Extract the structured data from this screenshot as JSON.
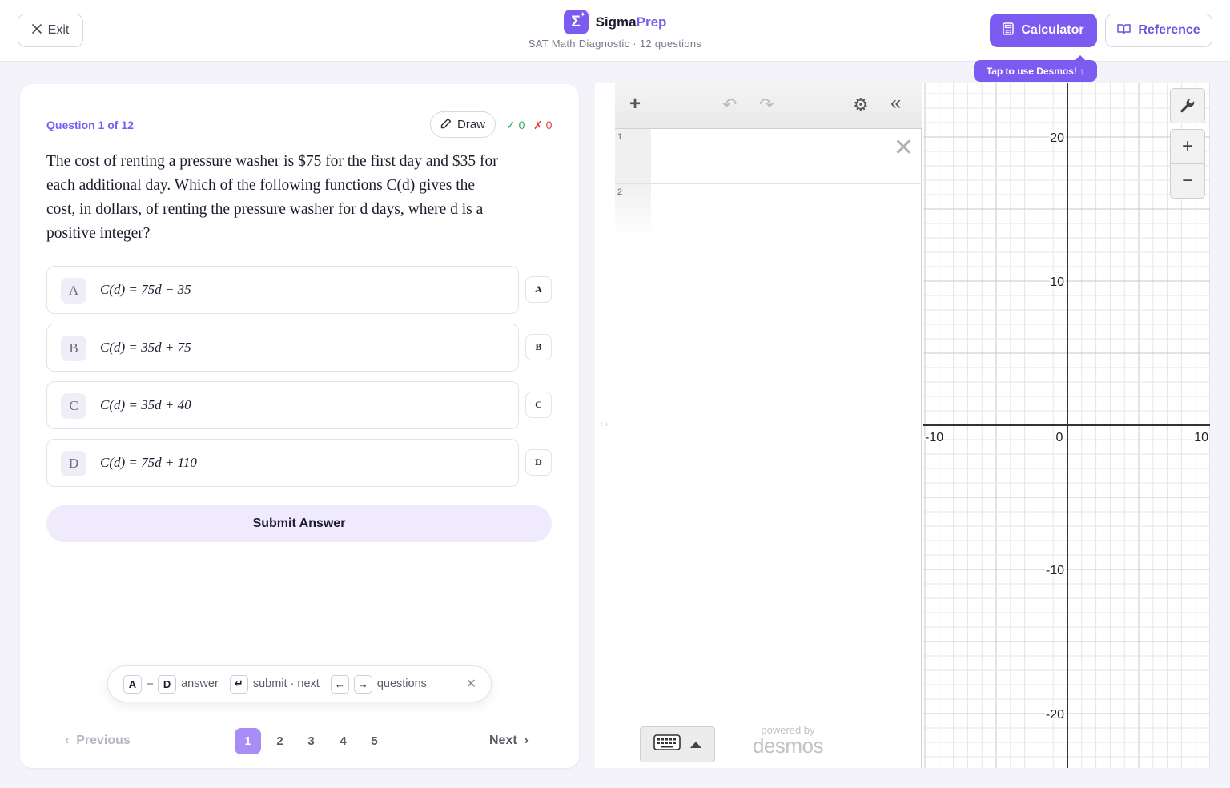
{
  "header": {
    "exit_label": "Exit",
    "brand_name": "Sigma",
    "brand_name_accent": "Prep",
    "brand_logo_glyph": "Σ",
    "subtitle": "SAT Math Diagnostic · 12 questions",
    "calculator_label": "Calculator",
    "reference_label": "Reference",
    "tooltip": "Tap to use Desmos! ↑",
    "accent_color": "#7c5cf0"
  },
  "question": {
    "label": "Question 1 of 12",
    "draw_label": "Draw",
    "correct_count": "✓ 0",
    "wrong_count": "✗ 0",
    "text_l1": "The cost of renting a pressure washer is $75 for the first day and $35 for",
    "text_l2": "each additional day. Which of the following functions C(d) gives the",
    "text_l3": "cost, in dollars, of renting the pressure washer for d days, where d is a",
    "text_l4": "positive integer?"
  },
  "choices": [
    {
      "letter": "A",
      "expr": "C(d) = 75d − 35",
      "strike": "A"
    },
    {
      "letter": "B",
      "expr": "C(d) = 35d + 75",
      "strike": "B"
    },
    {
      "letter": "C",
      "expr": "C(d) = 35d + 40",
      "strike": "C"
    },
    {
      "letter": "D",
      "expr": "C(d) = 75d + 110",
      "strike": "D"
    }
  ],
  "submit_label": "Submit Answer",
  "shortcuts": {
    "key_a": "A",
    "dash": "–",
    "key_d": "D",
    "answer": "answer",
    "key_enter": "↵",
    "submit_next": "submit · next",
    "key_left": "←",
    "key_right": "→",
    "questions": "questions",
    "close": "✕"
  },
  "pager": {
    "previous": "Previous",
    "next": "Next",
    "pages": [
      "1",
      "2",
      "3",
      "4",
      "5"
    ],
    "current_page": "1"
  },
  "calculator": {
    "expression_rows": [
      "1",
      "2"
    ],
    "powered_by": "powered by",
    "desmos": "desmos",
    "x_ticks": [
      "-10",
      "0",
      "10"
    ],
    "y_ticks": [
      "20",
      "10",
      "-10",
      "-20"
    ],
    "x_range": [
      -10,
      10
    ],
    "y_range": [
      -20,
      20
    ]
  }
}
